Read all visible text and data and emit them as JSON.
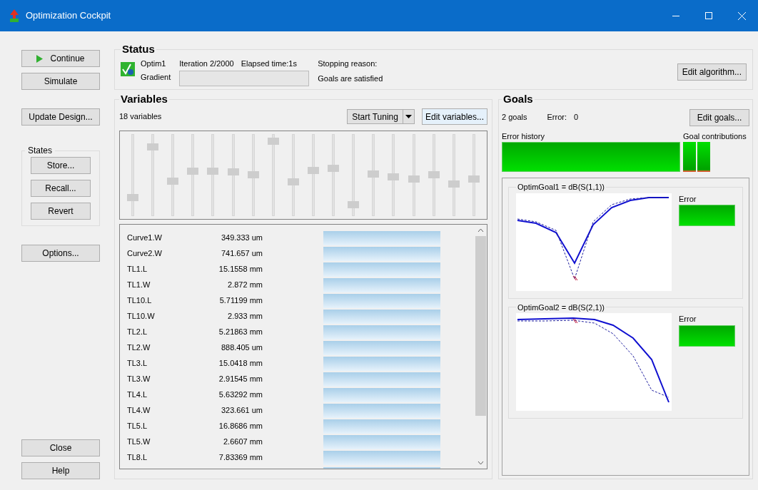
{
  "window": {
    "title": "Optimization Cockpit"
  },
  "side_buttons": [
    {
      "label": "Continue",
      "kind": "play"
    },
    {
      "label": "Simulate",
      "kind": "plain"
    },
    {
      "label": "Update Design...",
      "kind": "plain"
    }
  ],
  "states": {
    "title": "States",
    "buttons": [
      "Store...",
      "Recall...",
      "Revert"
    ]
  },
  "options_button": "Options...",
  "bottom_buttons": [
    "Close",
    "Help"
  ],
  "status": {
    "title": "Status",
    "optimizer": "Optim1",
    "method": "Gradient",
    "iteration": "Iteration 2/2000",
    "elapsed": "Elapsed time:1s",
    "level": 0,
    "stopping_label": "Stopping reason:",
    "stopping_reason": "Goals are satisfied",
    "edit_button": "Edit algorithm..."
  },
  "variables": {
    "title": "Variables",
    "count": "18 variables",
    "tuning_button": "Start Tuning",
    "edit_button": "Edit variables...",
    "sliders": [
      {
        "level": 0.19
      },
      {
        "level": 0.88
      },
      {
        "level": 0.41
      },
      {
        "level": 0.55
      },
      {
        "level": 0.55
      },
      {
        "level": 0.54
      },
      {
        "level": 0.5
      },
      {
        "level": 0.96
      },
      {
        "level": 0.4
      },
      {
        "level": 0.56
      },
      {
        "level": 0.59
      },
      {
        "level": 0.09
      },
      {
        "level": 0.51
      },
      {
        "level": 0.47
      },
      {
        "level": 0.44
      },
      {
        "level": 0.5
      },
      {
        "level": 0.37
      },
      {
        "level": 0.44
      }
    ],
    "rows": [
      {
        "name": "Curve1.W",
        "value": "349.333 um"
      },
      {
        "name": "Curve2.W",
        "value": "741.657 um"
      },
      {
        "name": "TL1.L",
        "value": "15.1558 mm"
      },
      {
        "name": "TL1.W",
        "value": "2.872 mm"
      },
      {
        "name": "TL10.L",
        "value": "5.71199 mm"
      },
      {
        "name": "TL10.W",
        "value": "2.933 mm"
      },
      {
        "name": "TL2.L",
        "value": "5.21863 mm"
      },
      {
        "name": "TL2.W",
        "value": "888.405 um"
      },
      {
        "name": "TL3.L",
        "value": "15.0418 mm"
      },
      {
        "name": "TL3.W",
        "value": "2.91545 mm"
      },
      {
        "name": "TL4.L",
        "value": "5.63292 mm"
      },
      {
        "name": "TL4.W",
        "value": "323.661 um"
      },
      {
        "name": "TL5.L",
        "value": "16.8686 mm"
      },
      {
        "name": "TL5.W",
        "value": "2.6607 mm"
      },
      {
        "name": "TL8.L",
        "value": "7.83369 mm"
      }
    ]
  },
  "goals": {
    "title": "Goals",
    "count": "2 goals",
    "error_label": "Error:",
    "error_value": "0",
    "edit_button": "Edit goals...",
    "history_label": "Error history",
    "contributions_label": "Goal contributions",
    "plots": [
      {
        "title": "OptimGoal1 = dB(S(1,1))",
        "error_label": "Error",
        "kind": "dip"
      },
      {
        "title": "OptimGoal2 = dB(S(2,1))",
        "error_label": "Error",
        "kind": "rolloff"
      }
    ]
  }
}
